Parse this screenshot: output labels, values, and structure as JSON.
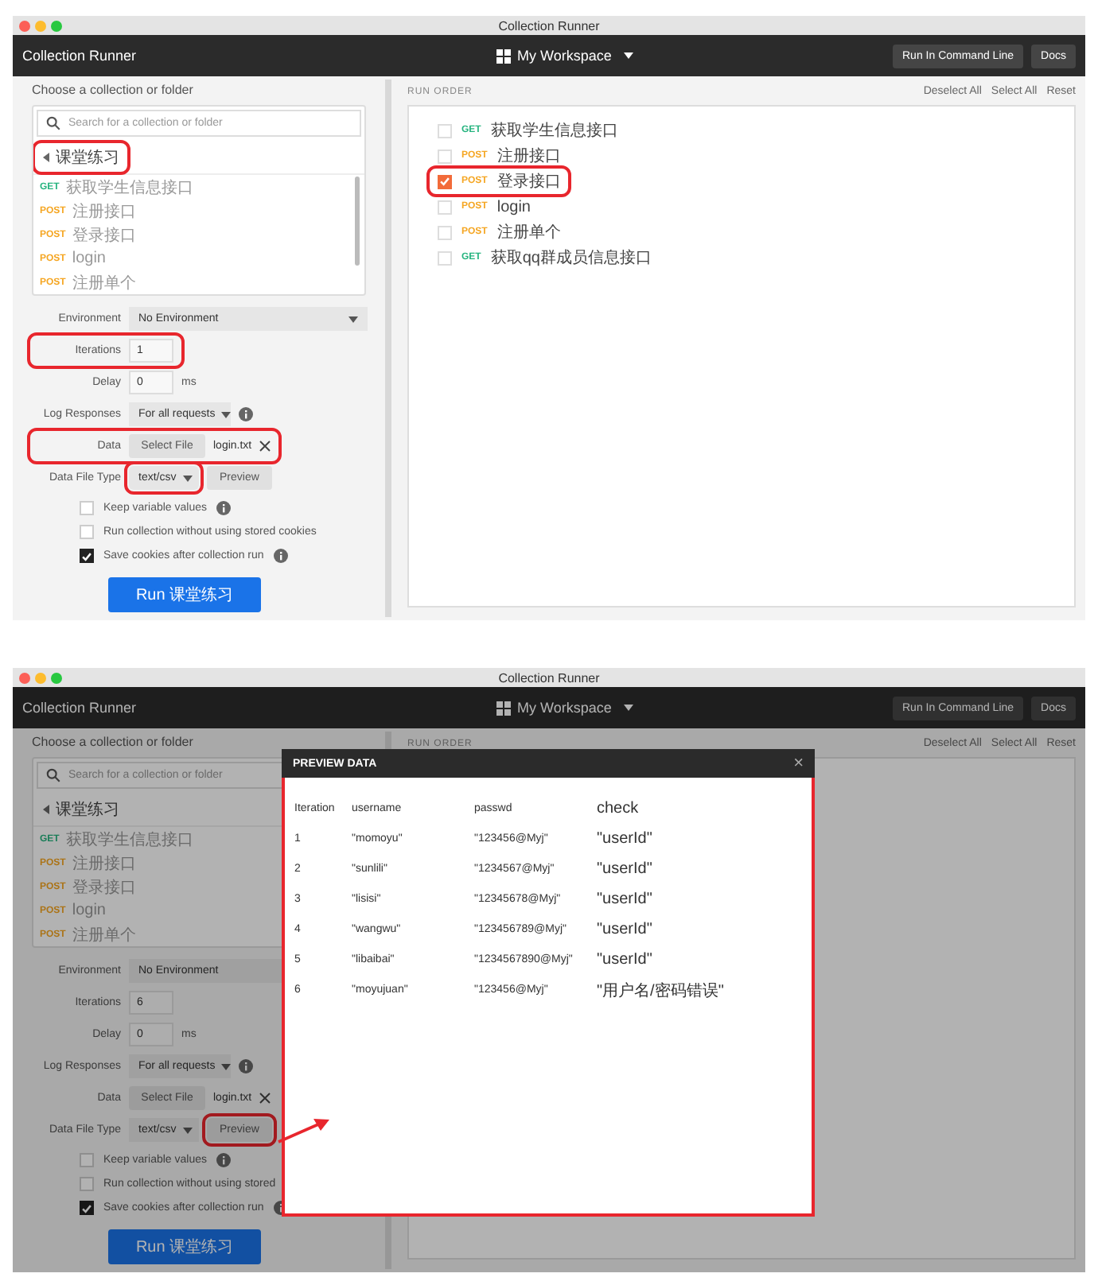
{
  "screens": [
    {
      "window_title": "Collection Runner",
      "app_title": "Collection Runner",
      "workspace": "My Workspace",
      "header_buttons": [
        "Run In Command Line",
        "Docs"
      ],
      "choose_label": "Choose a collection or folder",
      "search_placeholder": "Search for a collection or folder",
      "folder": {
        "name": "课堂练习",
        "highlighted": true
      },
      "requests": [
        {
          "method": "GET",
          "kind": "get",
          "name": "获取学生信息接口"
        },
        {
          "method": "POST",
          "kind": "post",
          "name": "注册接口"
        },
        {
          "method": "POST",
          "kind": "post",
          "name": "登录接口"
        },
        {
          "method": "POST",
          "kind": "post",
          "name": "login"
        },
        {
          "method": "POST",
          "kind": "post",
          "name": "注册单个"
        }
      ],
      "environment": {
        "label": "Environment",
        "value": "No Environment"
      },
      "iterations": {
        "label": "Iterations",
        "value": "1",
        "highlighted": true
      },
      "delay": {
        "label": "Delay",
        "value": "0",
        "unit": "ms"
      },
      "log_responses": {
        "label": "Log Responses",
        "value": "For all requests"
      },
      "data": {
        "label": "Data",
        "button": "Select File",
        "file": "login.txt",
        "highlighted": true
      },
      "data_file_type": {
        "label": "Data File Type",
        "value": "text/csv",
        "highlighted": true
      },
      "preview": {
        "label": "Preview",
        "highlighted": false
      },
      "options": [
        {
          "label": "Keep variable values",
          "checked": false,
          "info": true
        },
        {
          "label": "Run collection without using stored cookies",
          "checked": false,
          "info": false
        },
        {
          "label": "Save cookies after collection run",
          "checked": true,
          "info": true
        }
      ],
      "run_button": "Run 课堂练习",
      "run_order": {
        "title": "RUN ORDER",
        "actions": [
          "Deselect All",
          "Select All",
          "Reset"
        ],
        "items": [
          {
            "method": "GET",
            "kind": "get",
            "name": "获取学生信息接口",
            "checked": false,
            "highlighted": false
          },
          {
            "method": "POST",
            "kind": "post",
            "name": "注册接口",
            "checked": false,
            "highlighted": false
          },
          {
            "method": "POST",
            "kind": "post",
            "name": "登录接口",
            "checked": true,
            "highlighted": true
          },
          {
            "method": "POST",
            "kind": "post",
            "name": "login",
            "checked": false,
            "highlighted": false
          },
          {
            "method": "POST",
            "kind": "post",
            "name": "注册单个",
            "checked": false,
            "highlighted": false
          },
          {
            "method": "GET",
            "kind": "get",
            "name": "获取qq群成员信息接口",
            "checked": false,
            "highlighted": false
          }
        ]
      }
    },
    {
      "window_title": "Collection Runner",
      "app_title": "Collection Runner",
      "workspace": "My Workspace",
      "header_buttons": [
        "Run In Command Line",
        "Docs"
      ],
      "choose_label": "Choose a collection or folder",
      "search_placeholder": "Search for a collection or folder",
      "folder": {
        "name": "课堂练习",
        "highlighted": false
      },
      "requests": [
        {
          "method": "GET",
          "kind": "get",
          "name": "获取学生信息接口"
        },
        {
          "method": "POST",
          "kind": "post",
          "name": "注册接口"
        },
        {
          "method": "POST",
          "kind": "post",
          "name": "登录接口"
        },
        {
          "method": "POST",
          "kind": "post",
          "name": "login"
        },
        {
          "method": "POST",
          "kind": "post",
          "name": "注册单个"
        }
      ],
      "environment": {
        "label": "Environment",
        "value": "No Environment"
      },
      "iterations": {
        "label": "Iterations",
        "value": "6",
        "highlighted": false
      },
      "delay": {
        "label": "Delay",
        "value": "0",
        "unit": "ms"
      },
      "log_responses": {
        "label": "Log Responses",
        "value": "For all requests"
      },
      "data": {
        "label": "Data",
        "button": "Select File",
        "file": "login.txt",
        "highlighted": false
      },
      "data_file_type": {
        "label": "Data File Type",
        "value": "text/csv",
        "highlighted": false
      },
      "preview": {
        "label": "Preview",
        "highlighted": true
      },
      "pointer_arrow": true,
      "options": [
        {
          "label": "Keep variable values",
          "checked": false,
          "info": true
        },
        {
          "label": "Run collection without using stored",
          "checked": false,
          "info": false
        },
        {
          "label": "Save cookies after collection run",
          "checked": true,
          "info": true
        }
      ],
      "run_button": "Run 课堂练习",
      "run_order": {
        "title": "RUN ORDER",
        "actions": [
          "Deselect All",
          "Select All",
          "Reset"
        ]
      },
      "preview_modal": {
        "title": "PREVIEW DATA",
        "close": "×",
        "highlighted": true,
        "columns": [
          "Iteration",
          "username",
          "passwd",
          "check"
        ],
        "rows": [
          [
            "1",
            "\"momoyu\"",
            "\"123456@Myj\"",
            "\"userId\""
          ],
          [
            "2",
            "\"sunlili\"",
            "\"1234567@Myj\"",
            "\"userId\""
          ],
          [
            "3",
            "\"lisisi\"",
            "\"12345678@Myj\"",
            "\"userId\""
          ],
          [
            "4",
            "\"wangwu\"",
            "\"123456789@Myj\"",
            "\"userId\""
          ],
          [
            "5",
            "\"libaibai\"",
            "\"1234567890@Myj\"",
            "\"userId\""
          ],
          [
            "6",
            "\"moyujuan\"",
            "\"123456@Myj\"",
            "\"用户名/密码错误\""
          ]
        ]
      }
    }
  ]
}
